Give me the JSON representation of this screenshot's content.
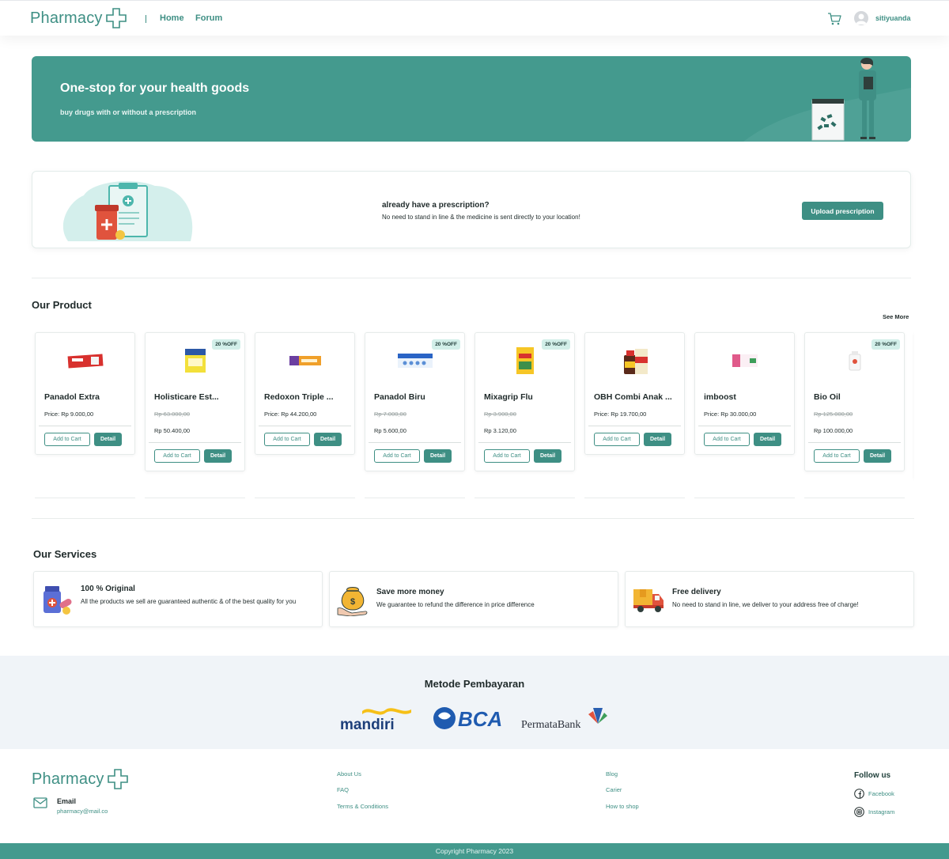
{
  "header": {
    "logo_text": "Pharmacy",
    "nav": [
      {
        "label": "Home"
      },
      {
        "label": "Forum"
      }
    ],
    "username": "sitiyuanda"
  },
  "hero": {
    "title": "One-stop for your health goods",
    "subtitle": "buy drugs with or without a prescription"
  },
  "prescription": {
    "title": "already have a prescription?",
    "description": "No need to stand in line & the medicine is sent directly to your location!",
    "button_label": "Upload prescription"
  },
  "products": {
    "title": "Our Product",
    "see_more_label": "See More",
    "add_to_cart_label": "Add to Cart",
    "detail_label": "Detail",
    "items": [
      {
        "name": "Panadol Extra",
        "price": "Price: Rp 9.000,00",
        "old_price": "",
        "new_price": "",
        "badge": ""
      },
      {
        "name": "Holisticare Est...",
        "price": "",
        "old_price": "Rp 63.000,00",
        "new_price": "Rp 50.400,00",
        "badge": "20 %OFF"
      },
      {
        "name": "Redoxon Triple ...",
        "price": "Price: Rp 44.200,00",
        "old_price": "",
        "new_price": "",
        "badge": ""
      },
      {
        "name": "Panadol Biru",
        "price": "",
        "old_price": "Rp 7.000,00",
        "new_price": "Rp 5.600,00",
        "badge": "20 %OFF"
      },
      {
        "name": "Mixagrip Flu",
        "price": "",
        "old_price": "Rp 3.900,00",
        "new_price": "Rp 3.120,00",
        "badge": "20 %OFF"
      },
      {
        "name": "OBH Combi Anak ...",
        "price": "Price: Rp 19.700,00",
        "old_price": "",
        "new_price": "",
        "badge": ""
      },
      {
        "name": "imboost",
        "price": "Price: Rp 30.000,00",
        "old_price": "",
        "new_price": "",
        "badge": ""
      },
      {
        "name": "Bio Oil",
        "price": "",
        "old_price": "Rp 125.000,00",
        "new_price": "Rp 100.000,00",
        "badge": "20 %OFF"
      }
    ]
  },
  "services": {
    "title": "Our Services",
    "items": [
      {
        "title": "100 % Original",
        "description": "All the products we sell are guaranteed authentic & of the best quality for you",
        "icon": "medicine-icon"
      },
      {
        "title": "Save more money",
        "description": "We guarantee to refund the difference in price difference",
        "icon": "money-bag-icon"
      },
      {
        "title": "Free delivery",
        "description": "No need to stand in line, we deliver to your address free of charge!",
        "icon": "delivery-truck-icon"
      }
    ]
  },
  "payment": {
    "title": "Metode Pembayaran",
    "banks": [
      "mandiri",
      "BCA",
      "PermataBank"
    ]
  },
  "footer": {
    "logo_text": "Pharmacy",
    "email_label": "Email",
    "email_value": "pharmacy@mail.co",
    "links_col1": [
      "About Us",
      "FAQ",
      "Terms & Conditions"
    ],
    "links_col2": [
      "Blog",
      "Carier",
      "How to shop"
    ],
    "follow_title": "Follow us",
    "social": [
      "Facebook",
      "Instagram"
    ],
    "copyright": "Copyright Pharmacy 2023"
  },
  "colors": {
    "primary": "#449a8e",
    "accent_text": "#3e8f84",
    "payment_bg": "#f0f4f8"
  }
}
